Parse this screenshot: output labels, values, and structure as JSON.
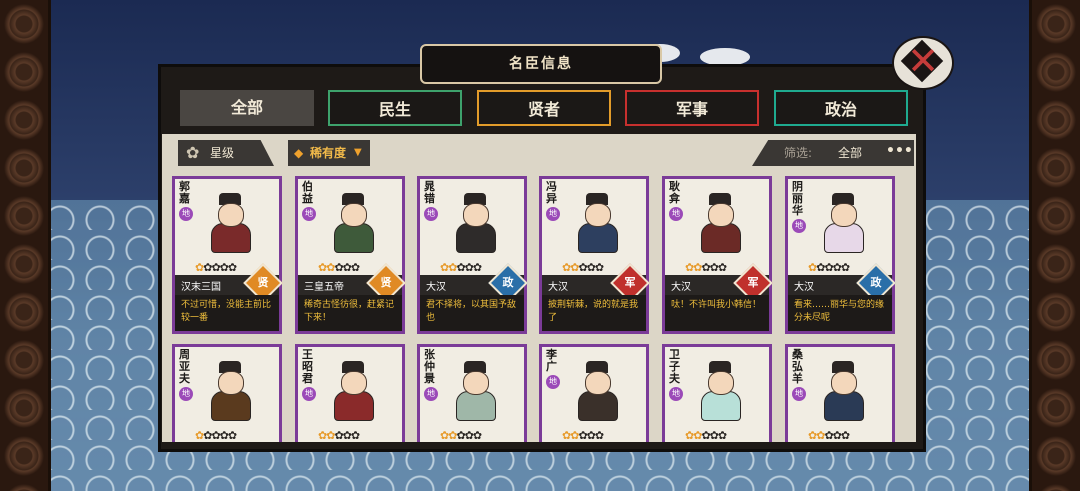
{
  "window": {
    "title": "名臣信息"
  },
  "tabs": [
    {
      "label": "全部",
      "key": "all"
    },
    {
      "label": "民生",
      "key": "ms"
    },
    {
      "label": "贤者",
      "key": "xz"
    },
    {
      "label": "军事",
      "key": "js"
    },
    {
      "label": "政治",
      "key": "zz"
    }
  ],
  "filters": {
    "star_label": "星级",
    "rarity_label": "稀有度",
    "screen_label": "筛选:",
    "screen_value": "全部",
    "more": "•••"
  },
  "close": {
    "glyph": "✕"
  },
  "tag_di": "地",
  "cards": [
    {
      "name": "郭嘉",
      "dynasty": "汉末三国",
      "badge": "贤",
      "quote": "不过可惜，没能主前比较一番",
      "stars_on": 1
    },
    {
      "name": "伯益",
      "dynasty": "三皇五帝",
      "badge": "贤",
      "quote": "稀奇古怪彷很，赶紧记下来！",
      "stars_on": 2
    },
    {
      "name": "晁错",
      "dynasty": "大汉",
      "badge": "政",
      "quote": "君不择将，以其国予敌也",
      "stars_on": 2
    },
    {
      "name": "冯异",
      "dynasty": "大汉",
      "badge": "军",
      "quote": "披荆斩棘，说的就是我了",
      "stars_on": 2
    },
    {
      "name": "耿弇",
      "dynasty": "大汉",
      "badge": "军",
      "quote": "呔！不许叫我小韩信！",
      "stars_on": 2
    },
    {
      "name": "阴丽华",
      "dynasty": "大汉",
      "badge": "政",
      "quote": "看来……丽华与您的缘分未尽呢",
      "stars_on": 1
    },
    {
      "name": "周亚夫",
      "dynasty": "",
      "badge": "",
      "quote": "",
      "stars_on": 1
    },
    {
      "name": "王昭君",
      "dynasty": "",
      "badge": "",
      "quote": "",
      "stars_on": 2
    },
    {
      "name": "张仲景",
      "dynasty": "",
      "badge": "",
      "quote": "",
      "stars_on": 2
    },
    {
      "name": "李广",
      "dynasty": "",
      "badge": "",
      "quote": "",
      "stars_on": 2
    },
    {
      "name": "卫子夫",
      "dynasty": "",
      "badge": "",
      "quote": "",
      "stars_on": 2
    },
    {
      "name": "桑弘羊",
      "dynasty": "",
      "badge": "",
      "quote": "",
      "stars_on": 2
    }
  ],
  "badge_colors": {
    "贤": "#e08a24",
    "政": "#2a6fa8",
    "军": "#c0302c"
  },
  "body_colors": [
    "#7a2a2a",
    "#3e5a3a",
    "#2e2b2a",
    "#2d3f5f",
    "#6b2a26",
    "#e7d8e8",
    "#5a3a1e",
    "#8a2a2a",
    "#9fb7a8",
    "#3a302a",
    "#b8e0d8",
    "#2a3a55"
  ]
}
